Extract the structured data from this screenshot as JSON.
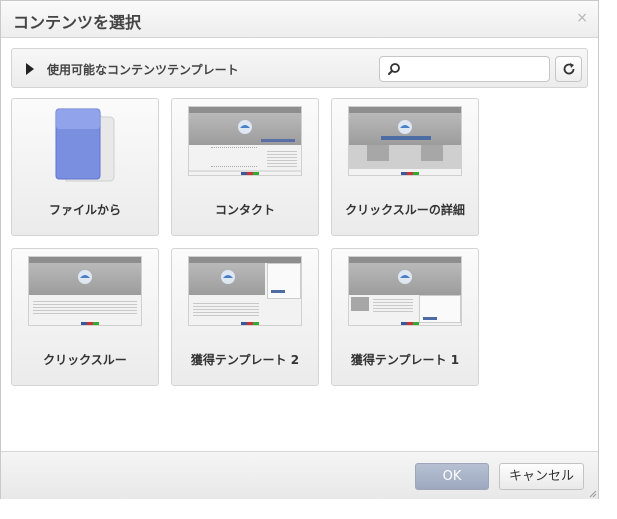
{
  "dialog": {
    "title": "コンテンツを選択",
    "close_label": "×"
  },
  "section": {
    "label": "使用可能なコンテンツテンプレート",
    "search": {
      "value": "",
      "placeholder": ""
    }
  },
  "tiles": [
    {
      "label": "ファイルから",
      "icon": "folder-icon"
    },
    {
      "label": "コンタクト",
      "icon": "template-thumbnail"
    },
    {
      "label": "クリックスルーの詳細",
      "icon": "template-thumbnail"
    },
    {
      "label": "クリックスルー",
      "icon": "template-thumbnail"
    },
    {
      "label": "獲得テンプレート 2",
      "icon": "template-thumbnail"
    },
    {
      "label": "獲得テンプレート 1",
      "icon": "template-thumbnail"
    }
  ],
  "footer": {
    "ok_label": "OK",
    "cancel_label": "キャンセル"
  },
  "colors": {
    "ok_button": "#a3adc3",
    "folder": "#6f86d8"
  }
}
